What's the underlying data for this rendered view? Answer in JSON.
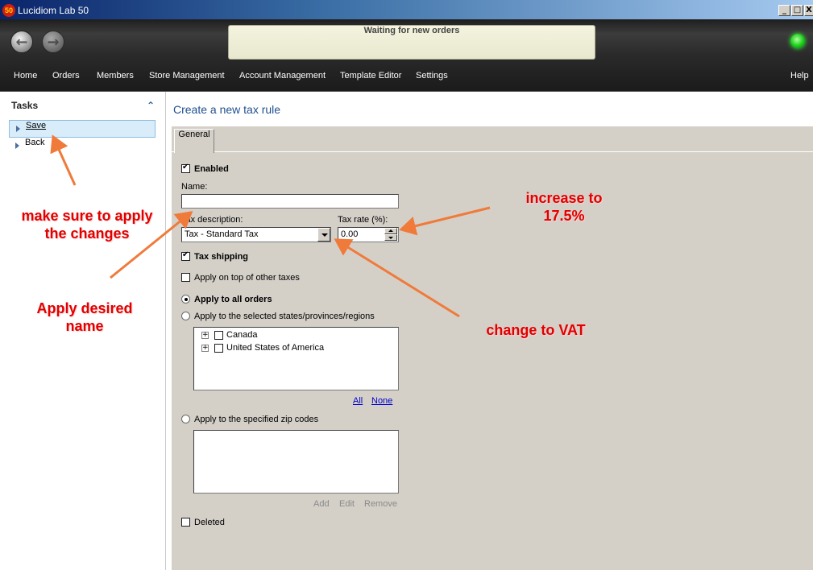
{
  "window": {
    "logo_text": "50",
    "title": "Lucidiom Lab 50",
    "controls": [
      "_",
      "□",
      "X"
    ]
  },
  "header": {
    "status": "Waiting for new orders",
    "menu": [
      "Home",
      "Orders",
      "Members",
      "Store Management",
      "Account Management",
      "Template Editor",
      "Settings",
      "Help"
    ]
  },
  "tasks": {
    "heading": "Tasks",
    "collapse_glyph": "⌃",
    "items": [
      {
        "label": "Save",
        "selected": true
      },
      {
        "label": "Back",
        "selected": false
      }
    ]
  },
  "main": {
    "title": "Create a new tax rule",
    "tab": "General",
    "enabled_label": "Enabled",
    "name_label": "Name:",
    "name_value": "",
    "tax_description_label": "Tax description:",
    "tax_description_value": "Tax - Standard Tax",
    "tax_rate_label": "Tax rate (%):",
    "tax_rate_value": "0.00",
    "tax_shipping_label": "Tax shipping",
    "apply_on_top_label": "Apply on top of other taxes",
    "apply_all_label": "Apply to all orders",
    "apply_states_label": "Apply to the selected states/provinces/regions",
    "regions": [
      "Canada",
      "United States of America"
    ],
    "all_link": "All",
    "none_link": "None",
    "apply_zip_label": "Apply to the specified zip codes",
    "zip_buttons": [
      "Add",
      "Edit",
      "Remove"
    ],
    "deleted_label": "Deleted"
  },
  "annotations": {
    "apply_changes": "make sure to apply the changes",
    "apply_name": "Apply desired name",
    "increase": "increase to 17.5%",
    "change_vat": "change to VAT",
    "color": "#e00000",
    "arrow_color": "#f07a3a"
  }
}
